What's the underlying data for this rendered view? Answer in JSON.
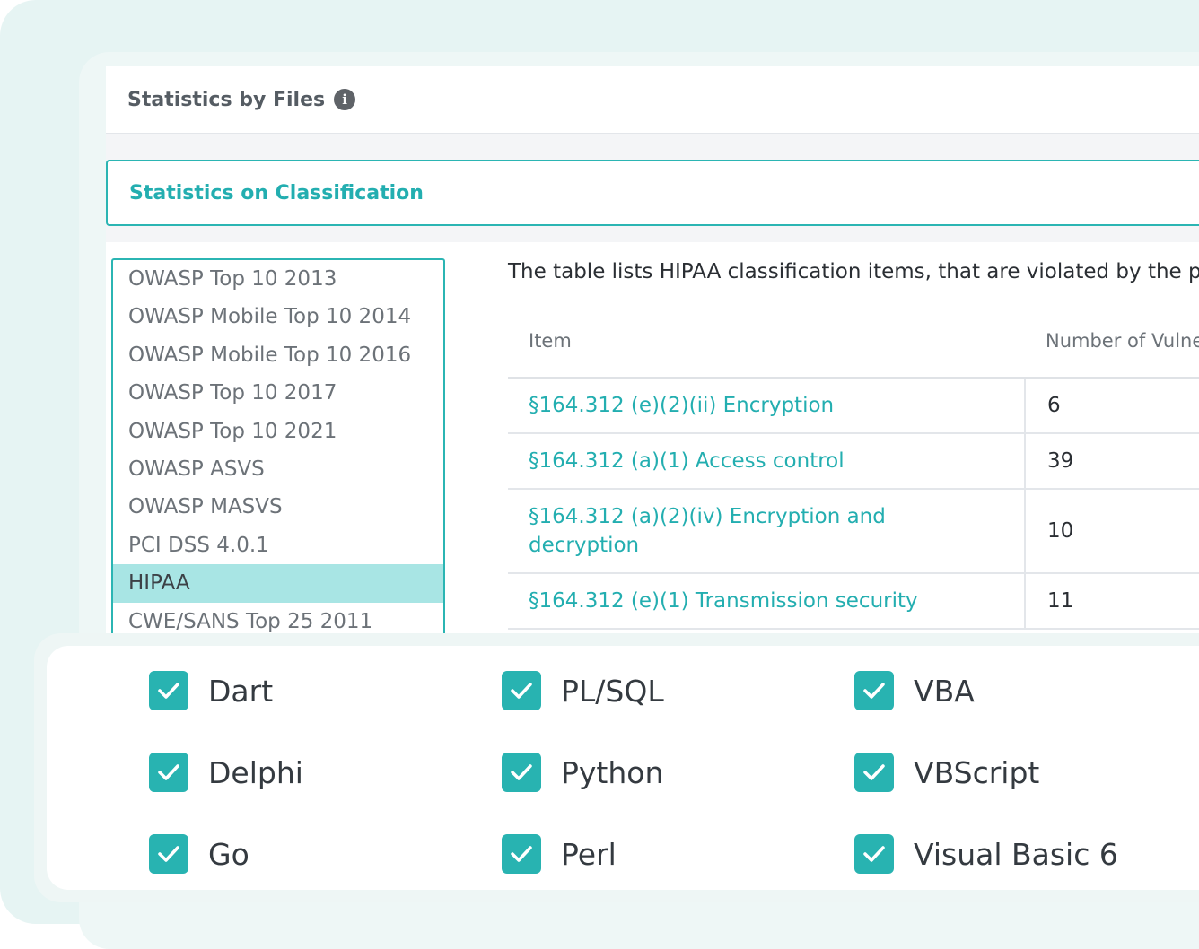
{
  "header": {
    "title": "Statistics by Files",
    "info_icon": "info-icon"
  },
  "section": {
    "title": "Statistics on Classification"
  },
  "classification_list": {
    "items": [
      "OWASP Top 10 2013",
      "OWASP Mobile Top 10 2014",
      "OWASP Mobile Top 10 2016",
      "OWASP Top 10 2017",
      "OWASP Top 10 2021",
      "OWASP ASVS",
      "OWASP MASVS",
      "PCI DSS 4.0.1",
      "HIPAA",
      "CWE/SANS Top 25 2011"
    ],
    "selected": "HIPAA"
  },
  "description": "The table lists HIPAA classification items, that are violated by the p",
  "table": {
    "headers": [
      "Item",
      "Number of Vulne"
    ],
    "rows": [
      {
        "item": "§164.312 (e)(2)(ii) Encryption",
        "count": "6"
      },
      {
        "item": "§164.312 (a)(1) Access control",
        "count": "39"
      },
      {
        "item": "§164.312 (a)(2)(iv) Encryption and decryption",
        "count": "10"
      },
      {
        "item": "§164.312 (e)(1) Transmission security",
        "count": "11"
      }
    ]
  },
  "languages": {
    "columns": [
      [
        "Dart",
        "Delphi",
        "Go"
      ],
      [
        "PL/SQL",
        "Python",
        "Perl"
      ],
      [
        "VBA",
        "VBScript",
        "Visual Basic 6"
      ]
    ],
    "checked": true,
    "check_icon": "checkmark-icon"
  },
  "colors": {
    "accent": "#2bb5b3",
    "selected_bg": "#a8e5e4",
    "background": "#e6f4f3",
    "checkbox": "#28b3b1"
  }
}
